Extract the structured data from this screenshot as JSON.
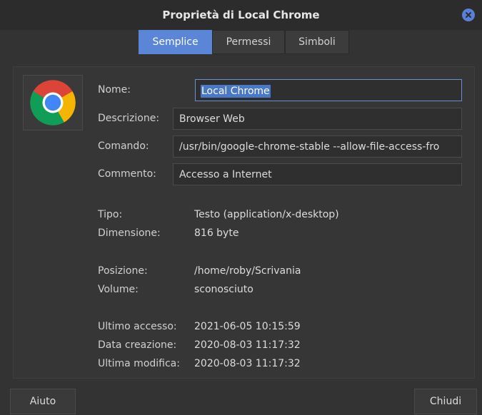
{
  "window": {
    "title": "Proprietà di Local Chrome"
  },
  "tabs": [
    {
      "label": "Semplice",
      "active": true
    },
    {
      "label": "Permessi",
      "active": false
    },
    {
      "label": "Simboli",
      "active": false
    }
  ],
  "app_icon": "chrome-icon",
  "fields": {
    "name": {
      "label": "Nome:",
      "value": "Local Chrome"
    },
    "description": {
      "label": "Descrizione:",
      "value": "Browser Web"
    },
    "command": {
      "label": "Comando:",
      "value": "/usr/bin/google-chrome-stable --allow-file-access-fro"
    },
    "comment": {
      "label": "Commento:",
      "value": "Accesso a Internet"
    }
  },
  "info": {
    "type": {
      "label": "Tipo:",
      "value": "Testo (application/x-desktop)"
    },
    "size": {
      "label": "Dimensione:",
      "value": "816 byte"
    },
    "location": {
      "label": "Posizione:",
      "value": "/home/roby/Scrivania"
    },
    "volume": {
      "label": "Volume:",
      "value": "sconosciuto"
    },
    "last_access": {
      "label": "Ultimo accesso:",
      "value": "2021-06-05 10:15:59"
    },
    "created": {
      "label": "Data creazione:",
      "value": "2020-08-03 11:17:32"
    },
    "modified": {
      "label": "Ultima modifica:",
      "value": "2020-08-03 11:17:32"
    }
  },
  "buttons": {
    "help": "Aiuto",
    "close": "Chiudi"
  },
  "colors": {
    "accent": "#5b85d6",
    "close_button": "#5a7fd8"
  }
}
